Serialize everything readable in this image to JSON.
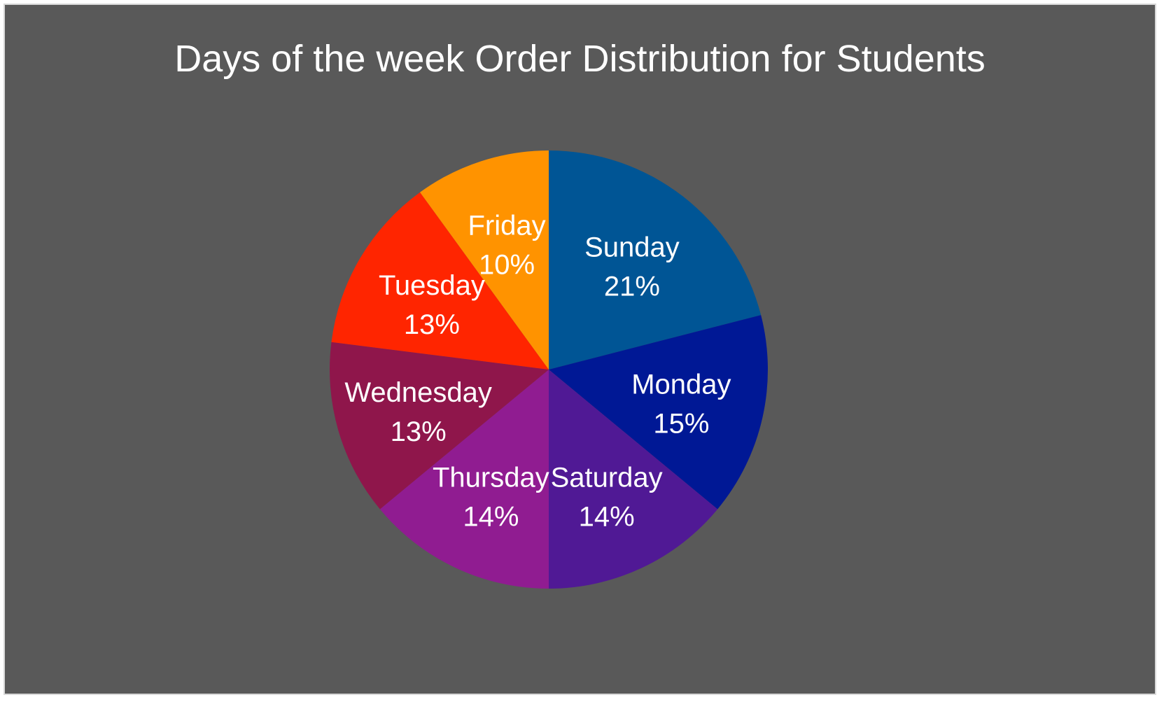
{
  "chart_data": {
    "type": "pie",
    "title": "Days of the week Order Distribution for Students",
    "start_angle_deg": 0,
    "direction": "clockwise",
    "legend": "none",
    "slices": [
      {
        "label": "Sunday",
        "value": 21,
        "value_label": "21%",
        "color": "#005595"
      },
      {
        "label": "Monday",
        "value": 15,
        "value_label": "15%",
        "color": "#001895"
      },
      {
        "label": "Saturday",
        "value": 14,
        "value_label": "14%",
        "color": "#501995"
      },
      {
        "label": "Thursday",
        "value": 14,
        "value_label": "14%",
        "color": "#901c91"
      },
      {
        "label": "Wednesday",
        "value": 13,
        "value_label": "13%",
        "color": "#8f164b"
      },
      {
        "label": "Tuesday",
        "value": 13,
        "value_label": "13%",
        "color": "#ff2500"
      },
      {
        "label": "Friday",
        "value": 10,
        "value_label": "10%",
        "color": "#ff9300"
      }
    ]
  },
  "colors": {
    "background": "#595959",
    "border": "#d9d9d9",
    "text": "#ffffff"
  }
}
